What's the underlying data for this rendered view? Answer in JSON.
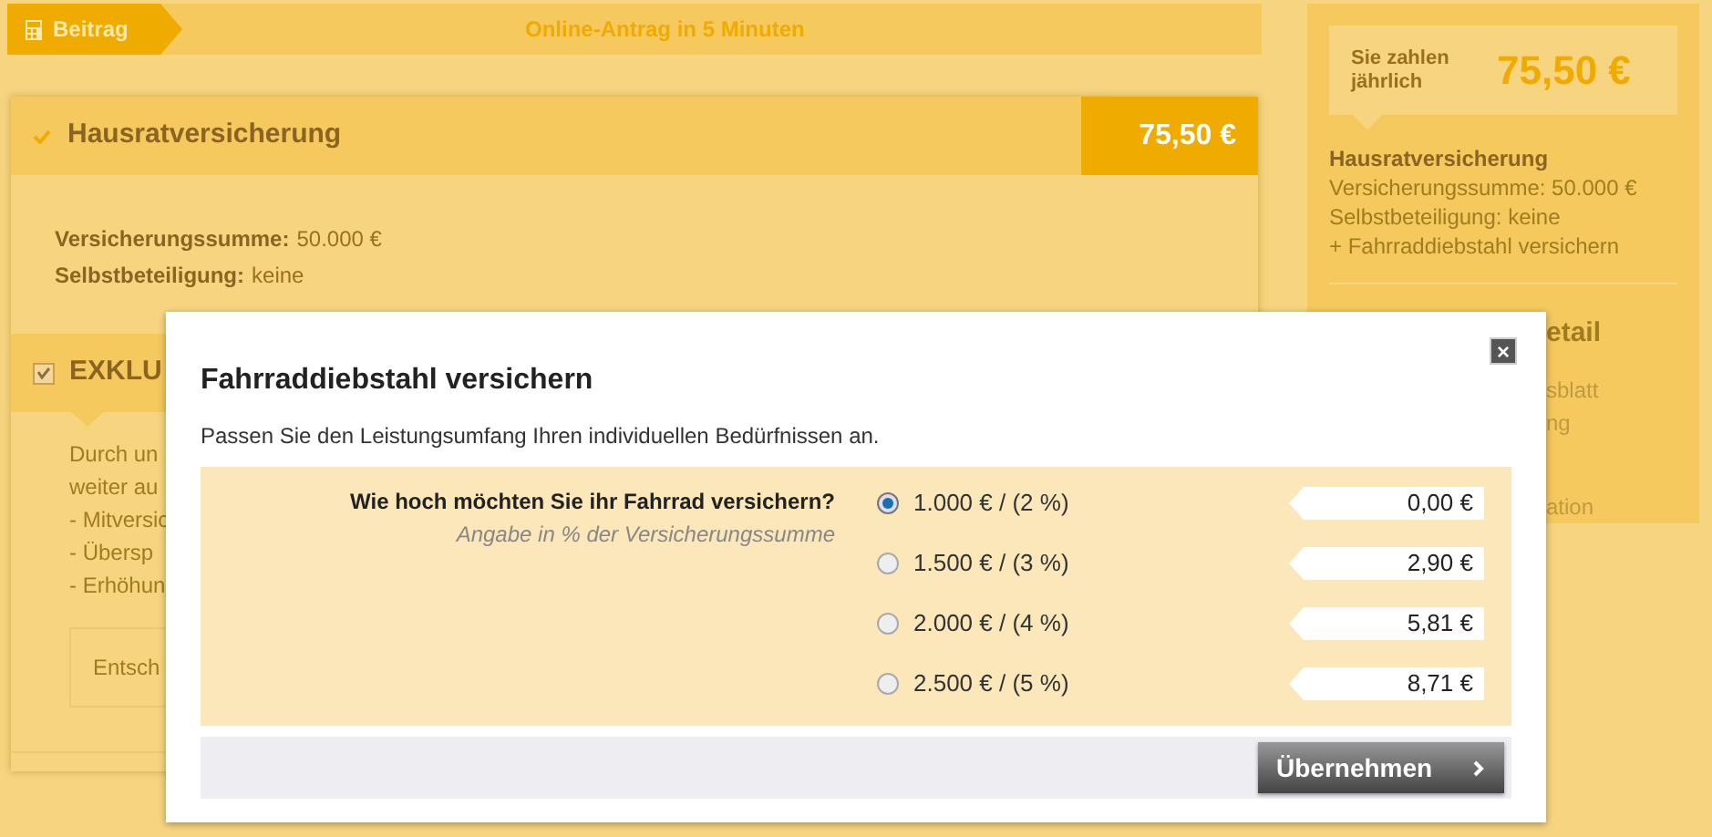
{
  "breadcrumb": {
    "step": "Beitrag",
    "tagline": "Online-Antrag in 5 Minuten"
  },
  "product": {
    "title": "Hausratversicherung",
    "price": "75,50 €",
    "details": [
      {
        "label": "Versicherungssumme:",
        "value": "50.000 €"
      },
      {
        "label": "Selbstbeteiligung:",
        "value": "keine"
      }
    ]
  },
  "addon": {
    "title": "EXKLU",
    "checked": true,
    "lines": [
      "Durch un",
      "weiter au",
      "- Mitversic",
      "- Übersp",
      "- Erhöhun"
    ],
    "box_text": "Entsch"
  },
  "summary": {
    "label": "Sie zahlen jährlich",
    "price": "75,50 €",
    "product": "Hausratversicherung",
    "lines": [
      "Versicherungssumme: 50.000 €",
      "Selbstbeteiligung: keine",
      "+ Fahrraddiebstahl versichern"
    ],
    "section_title": "etail",
    "links": [
      "sblatt",
      "ng",
      "ation"
    ]
  },
  "dialog": {
    "title": "Fahrraddiebstahl versichern",
    "subtitle": "Passen Sie den Leistungsumfang Ihren individuellen Bedürfnissen an.",
    "question": "Wie hoch möchten Sie ihr Fahrrad versichern?",
    "hint": "Angabe in % der Versicherungssumme",
    "options": [
      {
        "label": "1.000 € / (2 %)",
        "price": "0,00 €",
        "selected": true
      },
      {
        "label": "1.500 € / (3 %)",
        "price": "2,90 €",
        "selected": false
      },
      {
        "label": "2.000 € / (4 %)",
        "price": "5,81 €",
        "selected": false
      },
      {
        "label": "2.500 € / (5 %)",
        "price": "8,71 €",
        "selected": false
      }
    ],
    "button": "Übernehmen",
    "close": "×"
  }
}
